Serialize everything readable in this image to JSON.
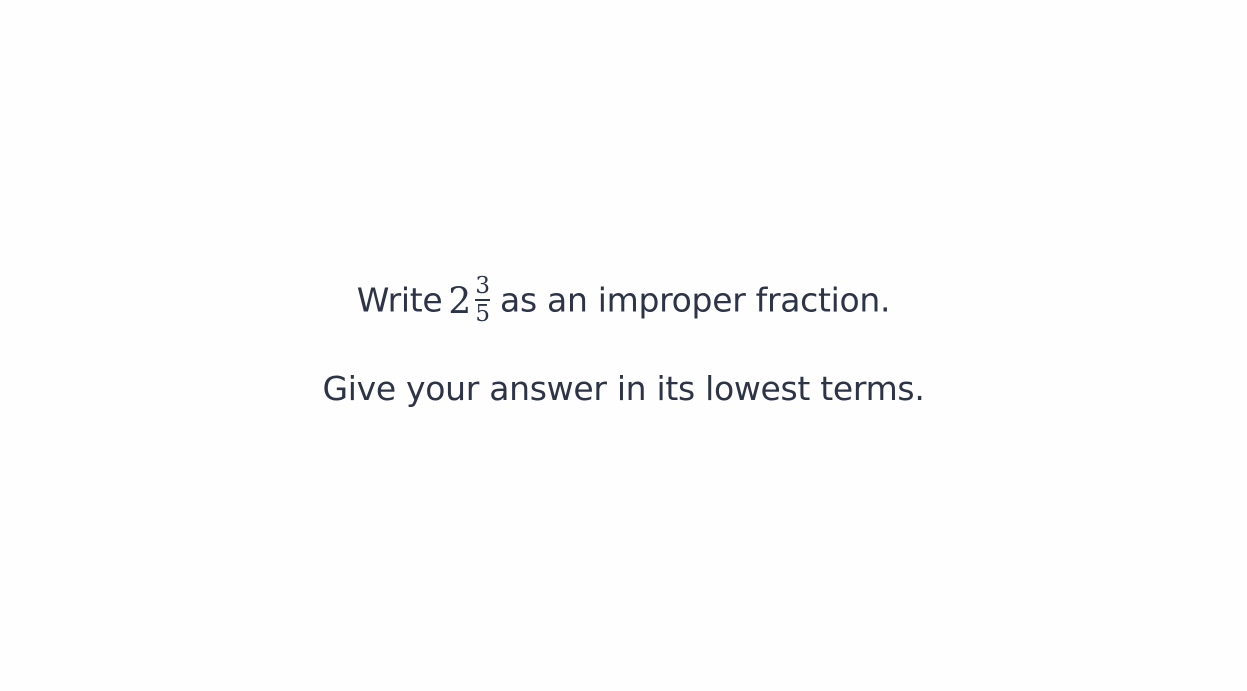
{
  "question": {
    "prefix": "Write",
    "mixed_number": {
      "whole": "2",
      "numerator": "3",
      "denominator": "5"
    },
    "suffix": "as an improper fraction.",
    "instruction": "Give your answer in its lowest terms."
  }
}
